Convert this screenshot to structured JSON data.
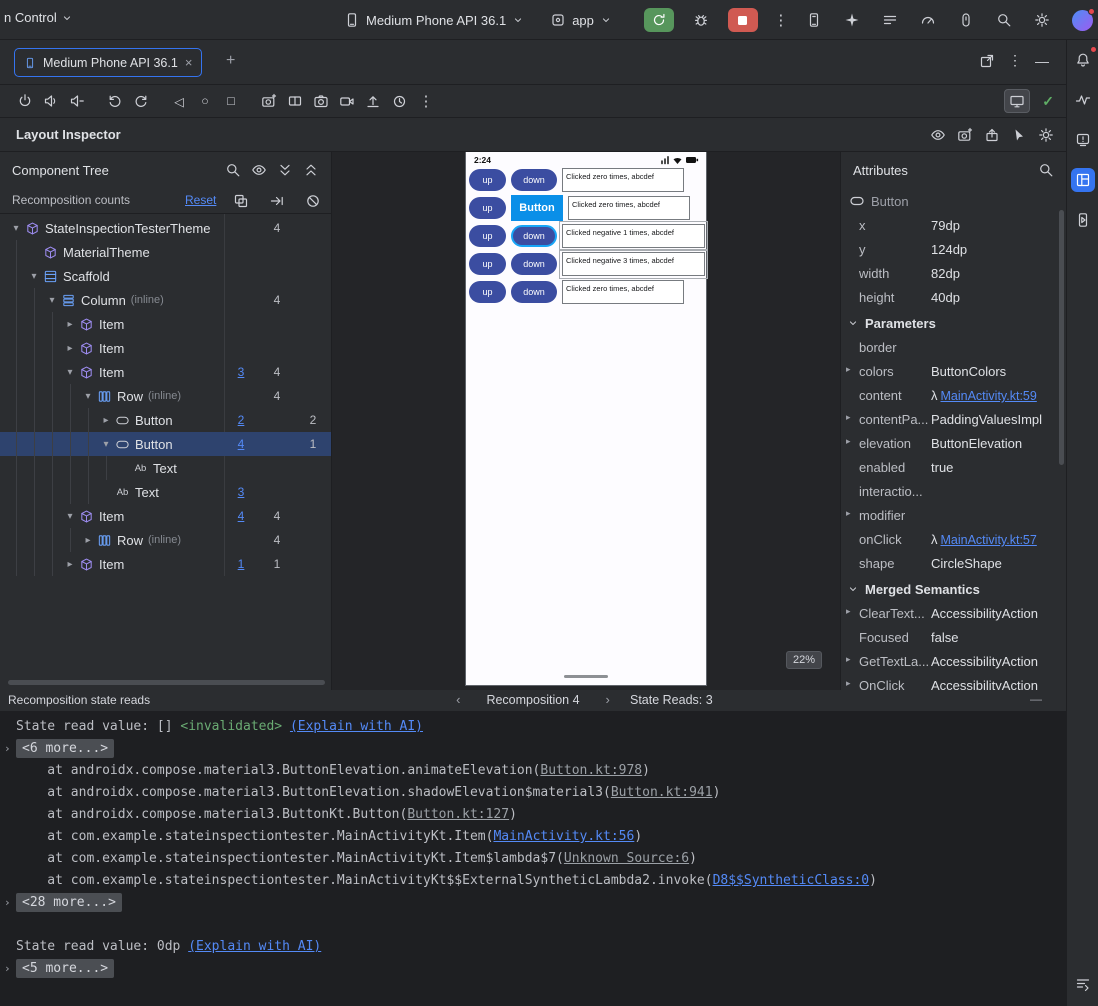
{
  "glyphs": {
    "more-vert": "⋮",
    "plus": "+",
    "close": "×",
    "minimize": "—",
    "check": "✓",
    "back": "◁",
    "home": "○",
    "overview": "□",
    "prev": "‹",
    "next": "›",
    "expanded": "▾",
    "collapsed": "▸",
    "fold": "›",
    "lambda": "λ",
    "text-node": "Ab"
  },
  "colors": {
    "accent": "#3574f0",
    "link": "#548af7",
    "selection": "#2e436e",
    "run_green": "#57965c",
    "stop_red": "#d05a52",
    "panel": "#2b2d30",
    "editor": "#1e1f22",
    "phone_button": "#3b4da1",
    "inspect_blue": "#0a8fe8",
    "invalidated_green": "#6aab73"
  },
  "titlebar": {
    "vcs_label": "n Control",
    "device": "Medium Phone API 36.1",
    "run_config": "app"
  },
  "tab_bar": {
    "tab": "Medium Phone API 36.1"
  },
  "inspector_header": {
    "title": "Layout Inspector"
  },
  "component_tree": {
    "title": "Component Tree",
    "counts_label": "Recomposition counts",
    "reset_label": "Reset",
    "rows": [
      {
        "depth": 0,
        "chevron": "down",
        "icon": "theme",
        "label": "StateInspectionTesterTheme",
        "c2": "4"
      },
      {
        "depth": 1,
        "chevron": "none",
        "icon": "theme",
        "label": "MaterialTheme"
      },
      {
        "depth": 1,
        "chevron": "down",
        "icon": "scaffold",
        "label": "Scaffold"
      },
      {
        "depth": 2,
        "chevron": "down",
        "icon": "column",
        "label": "Column",
        "suffix": "(inline)",
        "c2": "4"
      },
      {
        "depth": 3,
        "chevron": "right",
        "icon": "item",
        "label": "Item"
      },
      {
        "depth": 3,
        "chevron": "right",
        "icon": "item",
        "label": "Item"
      },
      {
        "depth": 3,
        "chevron": "down",
        "icon": "item",
        "label": "Item",
        "c1": "3",
        "c2": "4"
      },
      {
        "depth": 4,
        "chevron": "down",
        "icon": "row",
        "label": "Row",
        "suffix": "(inline)",
        "c2": "4"
      },
      {
        "depth": 5,
        "chevron": "right",
        "icon": "button",
        "label": "Button",
        "c1": "2",
        "c3": "2"
      },
      {
        "depth": 5,
        "chevron": "down",
        "icon": "button",
        "label": "Button",
        "c1": "4",
        "c3": "1",
        "selected": true
      },
      {
        "depth": 6,
        "chevron": "none",
        "icon": "text",
        "label": "Text"
      },
      {
        "depth": 5,
        "chevron": "none",
        "icon": "text",
        "label": "Text",
        "c1": "3"
      },
      {
        "depth": 3,
        "chevron": "down",
        "icon": "item",
        "label": "Item",
        "c1": "4",
        "c2": "4"
      },
      {
        "depth": 4,
        "chevron": "right",
        "icon": "row",
        "label": "Row",
        "suffix": "(inline)",
        "c2": "4"
      },
      {
        "depth": 3,
        "chevron": "right",
        "icon": "item",
        "label": "Item",
        "c1": "1",
        "c2": "1"
      }
    ]
  },
  "device_screen": {
    "status_time": "2:24",
    "up_label": "up",
    "down_label": "down",
    "overlay_label": "Button",
    "zoom_badge": "22%",
    "rows": [
      {
        "text": "Clicked zero times, abcdef"
      },
      {
        "text": "Clicked zero times, abcdef",
        "overlay": true
      },
      {
        "text": "Clicked negative 1 times, abcdef",
        "wide": true,
        "selected": true
      },
      {
        "text": "Clicked negative 3 times, abcdef",
        "wide": true
      },
      {
        "text": "Clicked zero times, abcdef"
      }
    ]
  },
  "attributes": {
    "title": "Attributes",
    "component": "Button",
    "props": [
      {
        "label": "x",
        "value": "79dp"
      },
      {
        "label": "y",
        "value": "124dp"
      },
      {
        "label": "width",
        "value": "82dp"
      },
      {
        "label": "height",
        "value": "40dp"
      }
    ],
    "sections": [
      {
        "title": "Parameters",
        "rows": [
          {
            "label": "border",
            "value": ""
          },
          {
            "label": "colors",
            "expand": true,
            "value": "ButtonColors"
          },
          {
            "label": "content",
            "lambda": true,
            "link": "MainActivity.kt:59"
          },
          {
            "label": "contentPa...",
            "expand": true,
            "value": "PaddingValuesImpl"
          },
          {
            "label": "elevation",
            "expand": true,
            "value": "ButtonElevation"
          },
          {
            "label": "enabled",
            "value": "true"
          },
          {
            "label": "interactio...",
            "value": ""
          },
          {
            "label": "modifier",
            "expand": true,
            "value": ""
          },
          {
            "label": "onClick",
            "lambda": true,
            "link": "MainActivity.kt:57"
          },
          {
            "label": "shape",
            "value": "CircleShape"
          }
        ]
      },
      {
        "title": "Merged Semantics",
        "rows": [
          {
            "label": "ClearText...",
            "expand": true,
            "value": "AccessibilityAction"
          },
          {
            "label": "Focused",
            "value": "false"
          },
          {
            "label": "GetTextLa...",
            "expand": true,
            "value": "AccessibilityAction"
          },
          {
            "label": "OnClick",
            "expand": true,
            "value": "AccessibilityAction"
          }
        ]
      }
    ]
  },
  "reads_bar": {
    "title": "Recomposition state reads",
    "nav_label": "Recomposition 4",
    "reads_label": "State Reads: 3"
  },
  "console": {
    "lines": [
      {
        "segments": [
          {
            "t": "State read value: [] "
          },
          {
            "t": "<invalidated>",
            "s": "val"
          },
          {
            "t": " "
          },
          {
            "t": "(Explain with AI)",
            "s": "link"
          }
        ]
      },
      {
        "fold": "<6 more...>"
      },
      {
        "segments": [
          {
            "t": "    at androidx.compose.material3.ButtonElevation.animateElevation("
          },
          {
            "t": "Button.kt:978",
            "s": "dim"
          },
          {
            "t": ")"
          }
        ]
      },
      {
        "segments": [
          {
            "t": "    at androidx.compose.material3.ButtonElevation.shadowElevation$material3("
          },
          {
            "t": "Button.kt:941",
            "s": "dim"
          },
          {
            "t": ")"
          }
        ]
      },
      {
        "segments": [
          {
            "t": "    at androidx.compose.material3.ButtonKt.Button("
          },
          {
            "t": "Button.kt:127",
            "s": "dim"
          },
          {
            "t": ")"
          }
        ]
      },
      {
        "segments": [
          {
            "t": "    at com.example.stateinspectiontester.MainActivityKt.Item("
          },
          {
            "t": "MainActivity.kt:56",
            "s": "link"
          },
          {
            "t": ")"
          }
        ]
      },
      {
        "segments": [
          {
            "t": "    at com.example.stateinspectiontester.MainActivityKt.Item$lambda$7("
          },
          {
            "t": "Unknown Source:6",
            "s": "dim"
          },
          {
            "t": ")"
          }
        ]
      },
      {
        "segments": [
          {
            "t": "    at com.example.stateinspectiontester.MainActivityKt$$ExternalSyntheticLambda2.invoke("
          },
          {
            "t": "D8$$SyntheticClass:0",
            "s": "link"
          },
          {
            "t": ")"
          }
        ]
      },
      {
        "fold": "<28 more...>"
      },
      {
        "segments": []
      },
      {
        "segments": [
          {
            "t": "State read value: 0dp "
          },
          {
            "t": "(Explain with AI)",
            "s": "link"
          }
        ]
      },
      {
        "fold": "<5 more...>"
      }
    ]
  }
}
